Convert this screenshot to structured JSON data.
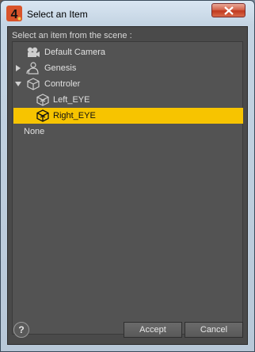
{
  "window": {
    "title": "Select an Item"
  },
  "dialog": {
    "prompt": "Select an item from the scene :",
    "items": [
      {
        "label": "Default Camera",
        "icon": "camera-icon"
      },
      {
        "label": "Genesis",
        "icon": "figure-icon",
        "expandable": true
      },
      {
        "label": "Controler",
        "icon": "cube-icon",
        "expanded": true
      },
      {
        "label": "Left_EYE",
        "icon": "cube-icon"
      },
      {
        "label": "Right_EYE",
        "icon": "cube-icon",
        "selected": true
      },
      {
        "label": "None"
      }
    ],
    "selected_color": "#f7c400",
    "help_label": "?",
    "accept_label": "Accept",
    "cancel_label": "Cancel"
  }
}
